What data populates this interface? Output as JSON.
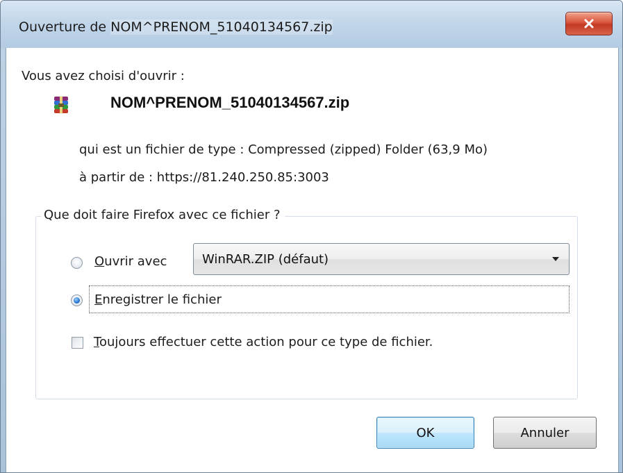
{
  "window": {
    "title_prefix": "Ouverture de",
    "title_filename": "NOM^PRENOM_51040134567.zip"
  },
  "dialog": {
    "chosen_label": "Vous avez choisi d'ouvrir :",
    "file_name": "NOM^PRENOM_51040134567.zip",
    "file_icon": "winrar-archive-icon",
    "type_line": "qui est un fichier de type : Compressed (zipped) Folder (63,9 Mo)",
    "from_line": "à partir de : https://81.240.250.85:3003",
    "question": "Que doit faire Firefox avec ce fichier ?"
  },
  "options": {
    "open_with": {
      "label_first": "O",
      "label_rest": "uvrir avec",
      "checked": false,
      "selected_app": "WinRAR.ZIP (défaut)"
    },
    "save_file": {
      "label_first": "E",
      "label_rest": "nregistrer le fichier",
      "checked": true
    },
    "always": {
      "label_first": "T",
      "label_rest": "oujours effectuer cette action pour ce type de fichier.",
      "checked": false
    }
  },
  "buttons": {
    "ok": "OK",
    "cancel": "Annuler"
  },
  "colors": {
    "titlebar": "#c2d6ea",
    "close_button": "#d9553d",
    "ok_border": "#3c7fb1"
  }
}
